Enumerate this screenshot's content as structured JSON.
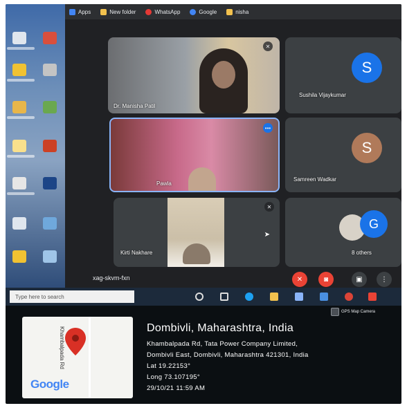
{
  "bookmarks": [
    {
      "label": "Apps",
      "icon": "apps-grid-icon",
      "color": "#4285f4"
    },
    {
      "label": "New folder",
      "icon": "folder-icon",
      "color": "#f2c14e"
    },
    {
      "label": "WhatsApp",
      "icon": "whatsapp-icon",
      "color": "#e53935"
    },
    {
      "label": "Google",
      "icon": "google-icon",
      "color": "#4285f4"
    },
    {
      "label": "nisha",
      "icon": "folder-icon",
      "color": "#f2c14e"
    }
  ],
  "meet": {
    "participants": [
      {
        "name": "Dr. Manisha Patil",
        "type": "video"
      },
      {
        "name": "Sushila Vijaykumar",
        "type": "avatar",
        "initial": "S",
        "avatar_color": "#1a73e8"
      },
      {
        "name": "Pawla",
        "type": "video",
        "active_speaker": true
      },
      {
        "name": "Samreen Wadkar",
        "type": "avatar",
        "initial": "S",
        "avatar_color": "#b07a5a"
      },
      {
        "name": "Kirti Nakhare",
        "type": "video"
      },
      {
        "name": "8 others",
        "type": "group",
        "initial": "G",
        "avatar_color": "#1a73e8"
      }
    ],
    "meeting_code": "xag-skvm-fxn",
    "more_options_symbol": "•••",
    "controls": {
      "mic": {
        "icon": "mic-off-icon",
        "color": "#ea4335"
      },
      "camera": {
        "icon": "camera-off-icon",
        "color": "#ea4335"
      },
      "present": {
        "icon": "present-screen-icon",
        "color": "#3c4043"
      },
      "more": {
        "icon": "more-vert-icon",
        "symbol": "⋮",
        "color": "#3c4043"
      }
    }
  },
  "taskbar": {
    "search_placeholder": "Type here to search"
  },
  "gps_stamp": {
    "badge": "GPS Map Camera",
    "map_logo": "Google",
    "street_label": "Khambalpada Rd",
    "title": "Dombivli, Maharashtra, India",
    "address_line1": "Khambalpada Rd, Tata Power Company Limited,",
    "address_line2": "Dombivli East, Dombivli, Maharashtra 421301, India",
    "lat": "Lat 19.22153°",
    "long": "Long 73.107195°",
    "datetime": "29/10/21 11:59 AM",
    "pin_color": "#d93025"
  }
}
